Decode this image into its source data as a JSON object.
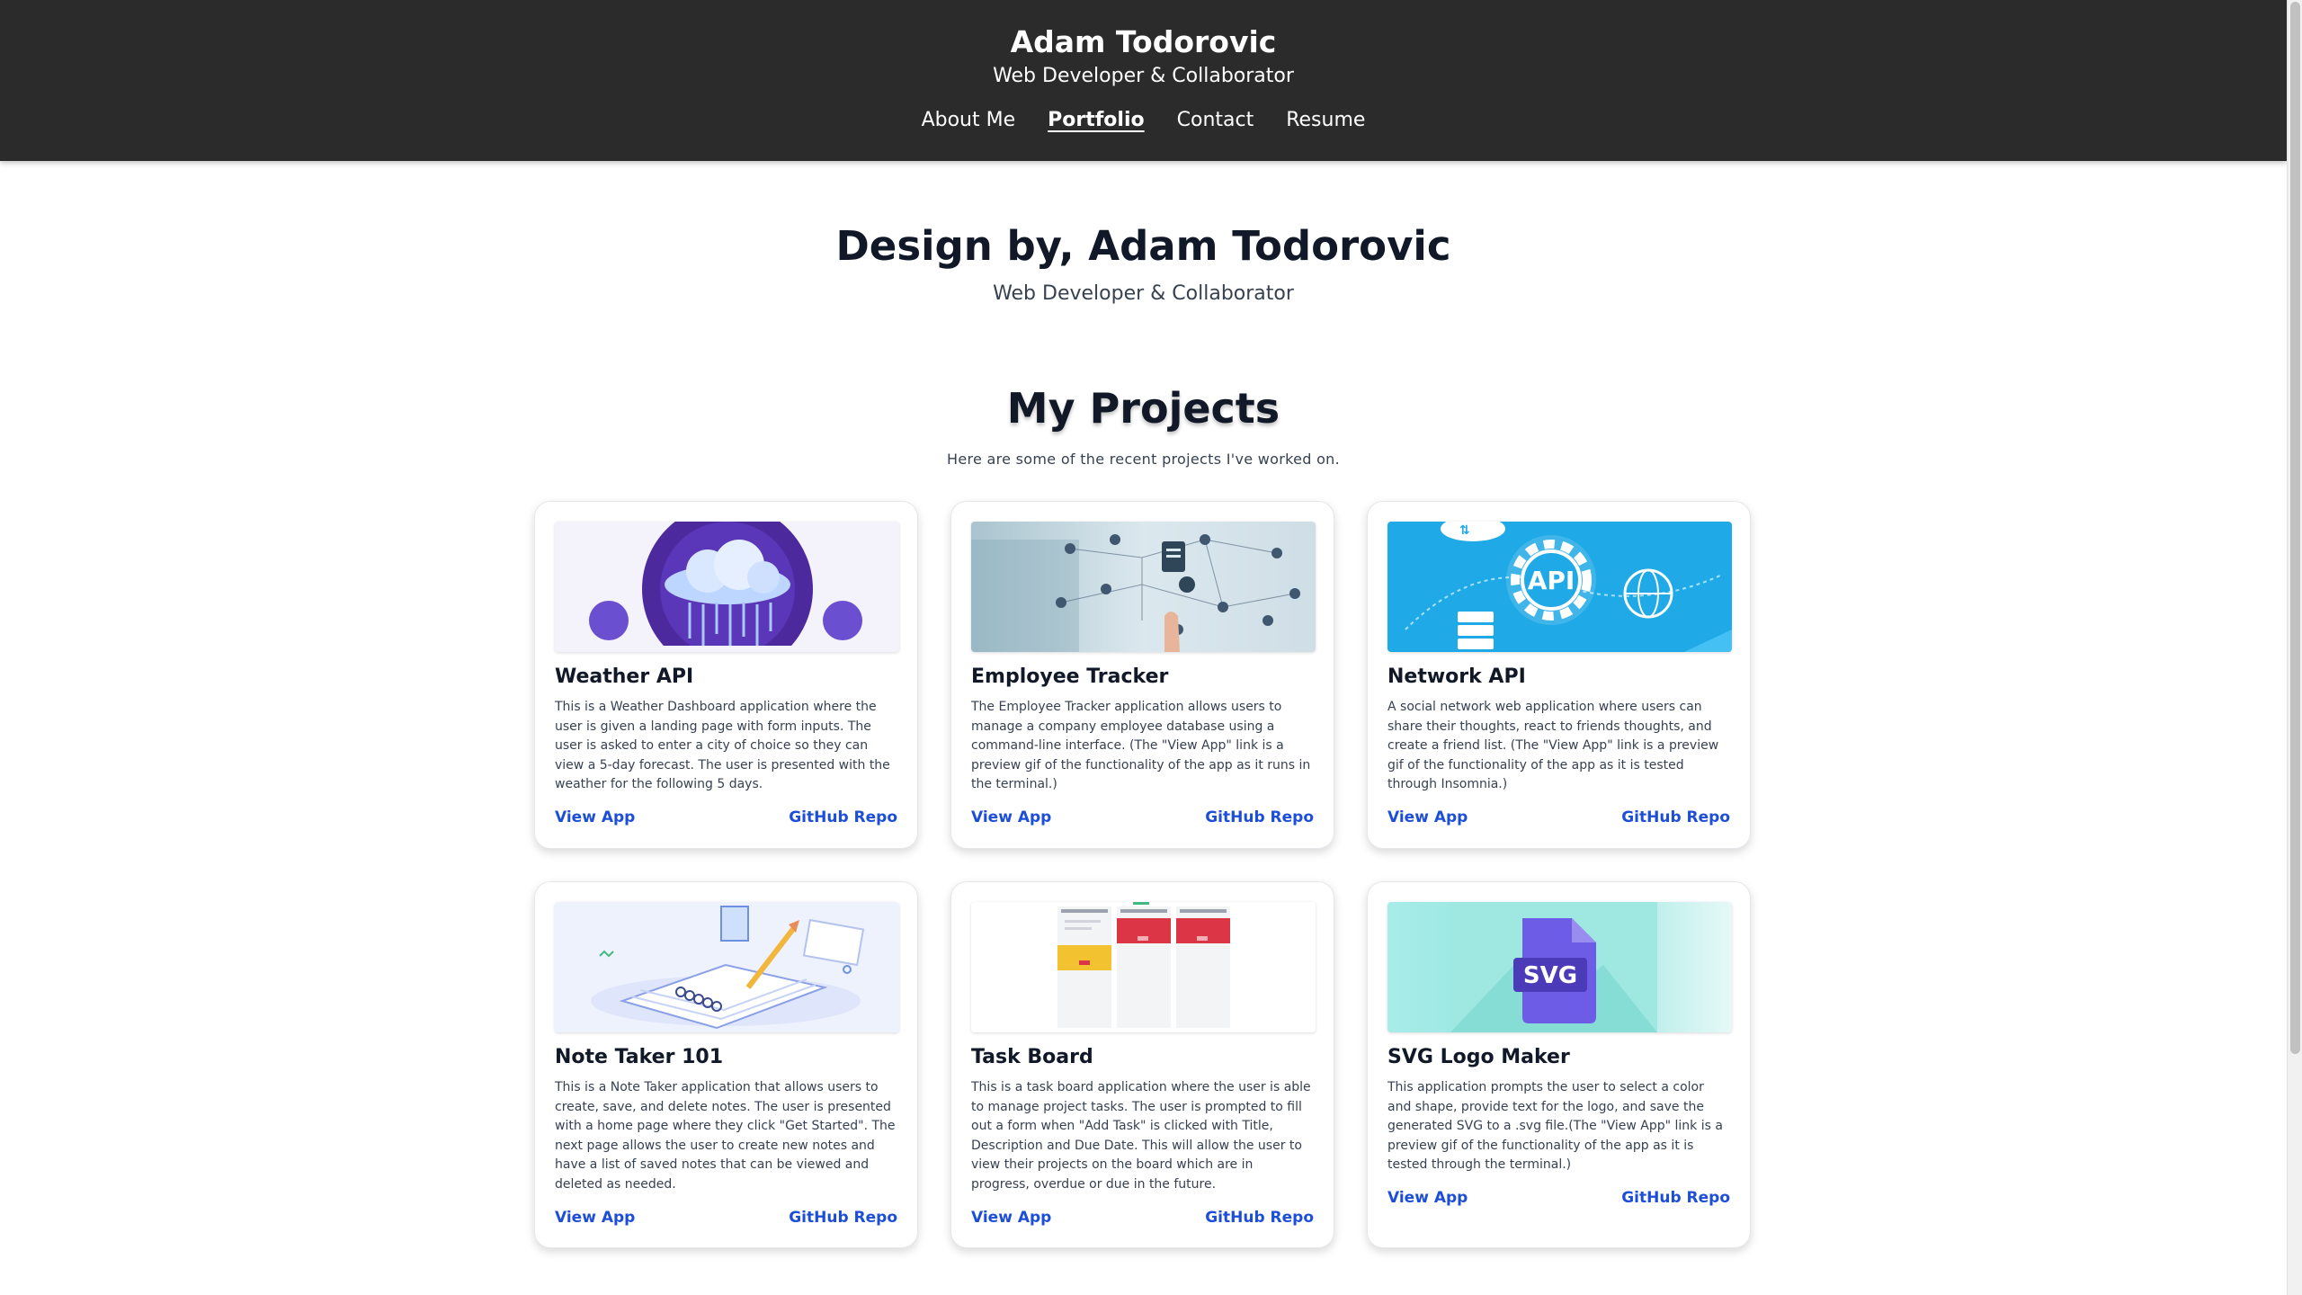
{
  "header": {
    "title": "Adam Todorovic",
    "subtitle": "Web Developer & Collaborator",
    "nav": [
      "About Me",
      "Portfolio",
      "Contact",
      "Resume"
    ],
    "active_nav": "Portfolio"
  },
  "hero": {
    "title": "Design by, Adam Todorovic",
    "subtitle": "Web Developer & Collaborator"
  },
  "projects": {
    "title": "My Projects",
    "intro": "Here are some of the recent projects I've worked on.",
    "items": [
      {
        "title": "Weather API",
        "description": "This is a Weather Dashboard application where the user is given a landing page with form inputs. The user is asked to enter a city of choice so they can view a 5-day forecast. The user is presented with the weather for the following 5 days.",
        "view_label": "View App",
        "repo_label": "GitHub Repo"
      },
      {
        "title": "Employee Tracker",
        "description": "The Employee Tracker application allows users to manage a company employee database using a command-line interface. (The \"View App\" link is a preview gif of the functionality of the app as it runs in the terminal.)",
        "view_label": "View App",
        "repo_label": "GitHub Repo"
      },
      {
        "title": "Network API",
        "description": "A social network web application where users can share their thoughts, react to friends thoughts, and create a friend list. (The \"View App\" link is a preview gif of the functionality of the app as it is tested through Insomnia.)",
        "view_label": "View App",
        "repo_label": "GitHub Repo"
      },
      {
        "title": "Note Taker 101",
        "description": "This is a Note Taker application that allows users to create, save, and delete notes. The user is presented with a home page where they click \"Get Started\". The next page allows the user to create new notes and have a list of saved notes that can be viewed and deleted as needed.",
        "view_label": "View App",
        "repo_label": "GitHub Repo"
      },
      {
        "title": "Task Board",
        "description": "This is a task board application where the user is able to manage project tasks. The user is prompted to fill out a form when \"Add Task\" is clicked with Title, Description and Due Date. This will allow the user to view their projects on the board which are in progress, overdue or due in the future.",
        "view_label": "View App",
        "repo_label": "GitHub Repo"
      },
      {
        "title": "SVG Logo Maker",
        "description": "This application prompts the user to select a color and shape, provide text for the logo, and save the generated SVG to a .svg file.(The \"View App\" link is a preview gif of the functionality of the app as it is tested through the terminal.)",
        "view_label": "View App",
        "repo_label": "GitHub Repo"
      }
    ],
    "thumbnail_text": {
      "network": "API",
      "svg": "SVG"
    }
  },
  "colors": {
    "header_bg": "#2b2b2b",
    "link": "#1d4ed8"
  }
}
